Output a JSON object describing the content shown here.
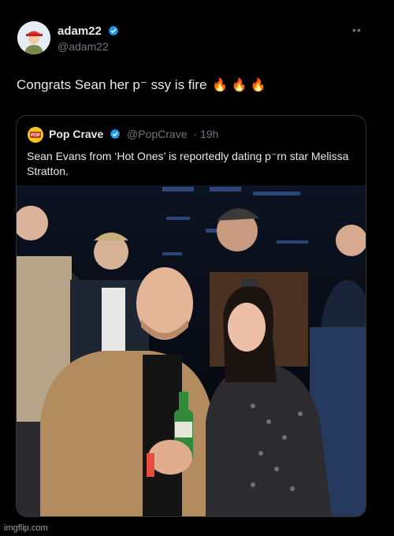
{
  "author": {
    "display_name": "adam22",
    "handle": "@adam22",
    "verified_icon": "verified-badge-icon",
    "avatar_icon": "cartoon-avatar-icon"
  },
  "tweet": {
    "text": "Congrats Sean her p⁻ ssy is fire",
    "emojis": "🔥 🔥 🔥"
  },
  "quoted": {
    "display_name": "Pop Crave",
    "handle": "@PopCrave",
    "time": "· 19h",
    "avatar_label": "POP CRAVE",
    "text": "Sean Evans from ‘Hot Ones’ is reportedly dating p⁻rn star Melissa Stratton."
  },
  "photo": {
    "description_icon": "event-photo-image"
  },
  "colors": {
    "background": "#000000",
    "verified": "#1d9bf0",
    "secondary_text": "#71767b",
    "border": "#2f3336"
  },
  "watermark": "imgflip.com"
}
